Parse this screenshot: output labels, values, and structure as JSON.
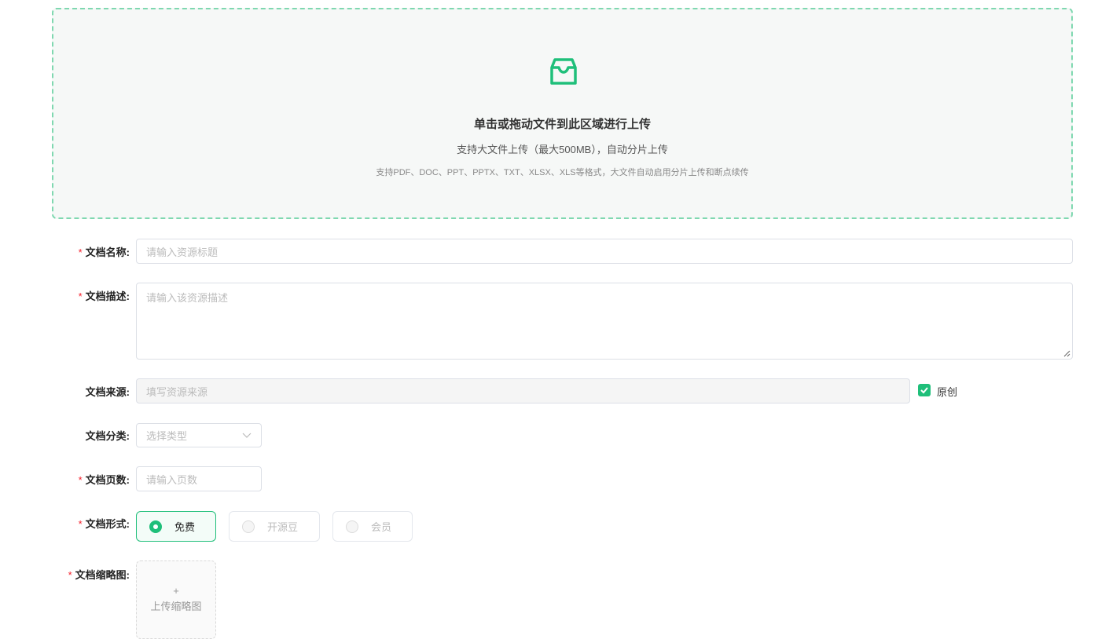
{
  "upload": {
    "icon": "inbox-icon",
    "title": "单击或拖动文件到此区域进行上传",
    "subtitle": "支持大文件上传（最大500MB），自动分片上传",
    "hint": "支持PDF、DOC、PPT、PPTX、TXT、XLSX、XLS等格式，大文件自动启用分片上传和断点续传"
  },
  "form": {
    "required_mark": "*",
    "name": {
      "label": "文档名称:",
      "placeholder": "请输入资源标题"
    },
    "desc": {
      "label": "文档描述:",
      "placeholder": "请输入该资源描述"
    },
    "source": {
      "label": "文档来源:",
      "placeholder": "填写资源来源",
      "original_label": "原创",
      "original_checked": true
    },
    "category": {
      "label": "文档分类:",
      "placeholder": "选择类型"
    },
    "pages": {
      "label": "文档页数:",
      "placeholder": "请输入页数"
    },
    "form_type": {
      "label": "文档形式:",
      "options": [
        "免费",
        "开源豆",
        "会员"
      ],
      "selected": "免费"
    },
    "thumbnail": {
      "label": "文档缩略图:",
      "plus": "+",
      "button": "上传缩略图"
    }
  },
  "colors": {
    "accent": "#1fbf7a",
    "required": "#f5222d"
  }
}
